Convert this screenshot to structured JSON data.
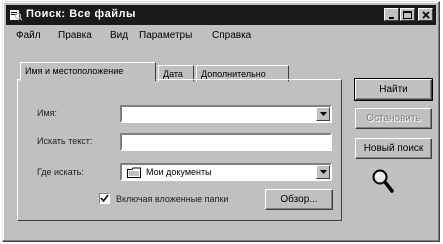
{
  "window": {
    "title": "Поиск: Все файлы"
  },
  "menu": [
    "Файл",
    "Правка",
    "Вид",
    "Параметры",
    "Справка"
  ],
  "tabs": [
    "Имя и местоположение",
    "Дата",
    "Дополнительно"
  ],
  "form": {
    "name_label": "Имя:",
    "name_value": "",
    "text_label": "Искать текст:",
    "text_value": "",
    "where_label": "Где искать:",
    "where_value": "Мои документы",
    "subfolders_label": "Включая вложенные папки",
    "subfolders_checked": true,
    "browse_label": "Обзор..."
  },
  "buttons": {
    "find": "Найти",
    "stop": "Остановить",
    "new_search": "Новый поиск"
  },
  "icons": {
    "title_icon": "search-window-icon",
    "folder": "folder-icon",
    "magnifier": "magnifier-icon"
  }
}
